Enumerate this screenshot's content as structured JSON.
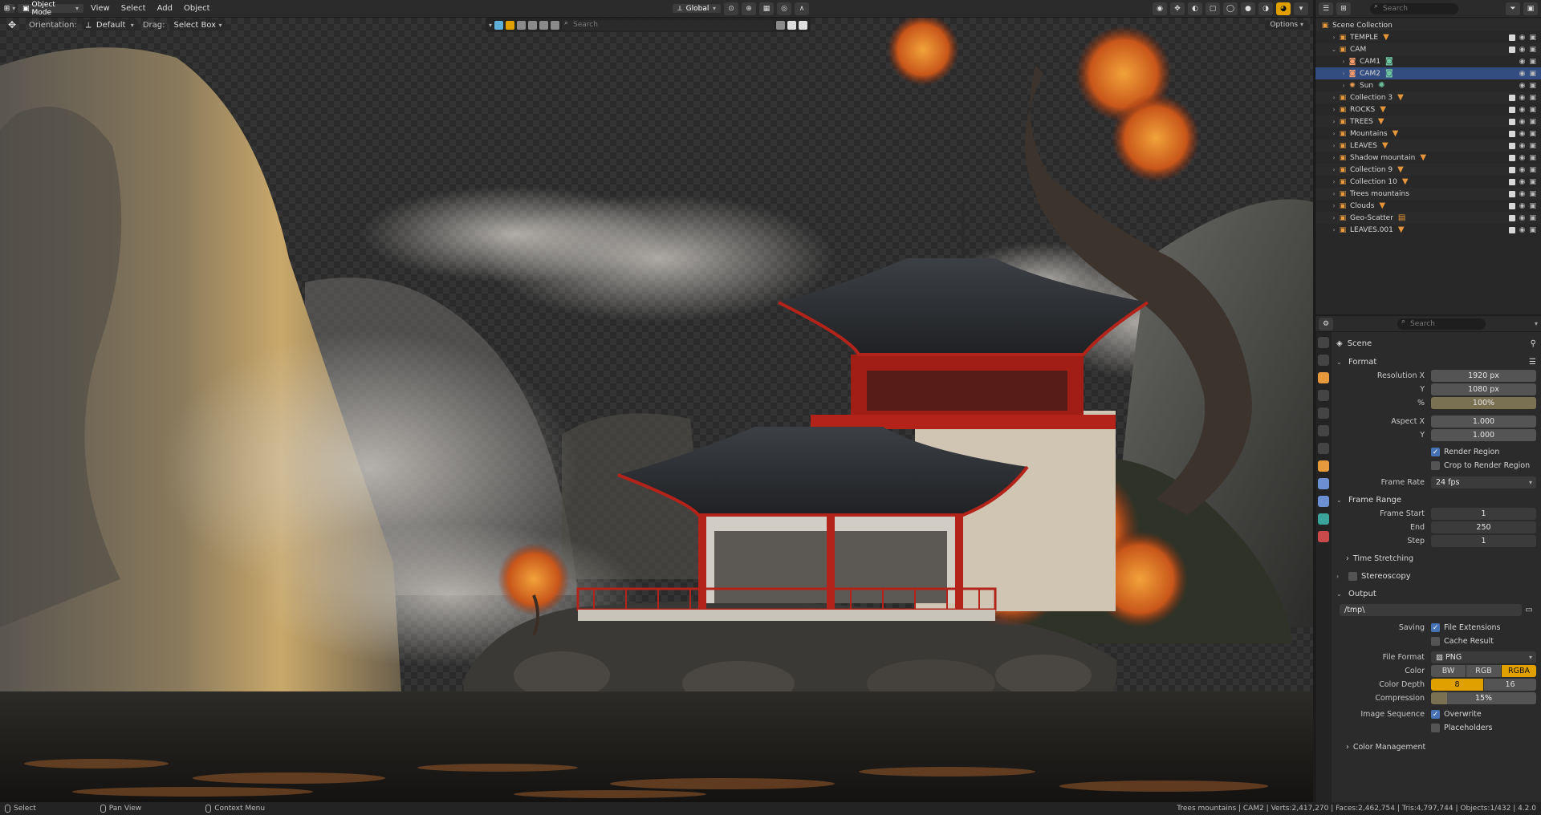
{
  "header": {
    "mode": "Object Mode",
    "menus": [
      "View",
      "Select",
      "Add",
      "Object"
    ],
    "transform_orientation": "Global"
  },
  "tool_settings": {
    "orientation_label": "Orientation:",
    "orientation_value": "Default",
    "drag_label": "Drag:",
    "drag_value": "Select Box",
    "options": "Options",
    "search_placeholder": "Search"
  },
  "outliner": {
    "search_placeholder": "Search",
    "items": [
      {
        "name": "Scene Collection",
        "level": 0,
        "icon": "collection-icon"
      },
      {
        "name": "TEMPLE",
        "level": 1,
        "icon": "collection-icon",
        "tag": "▼"
      },
      {
        "name": "CAM",
        "level": 1,
        "icon": "collection-icon",
        "expanded": true
      },
      {
        "name": "CAM1",
        "level": 2,
        "icon": "camera-icon",
        "tag": "◙"
      },
      {
        "name": "CAM2",
        "level": 2,
        "icon": "camera-icon",
        "tag": "◙",
        "selected": true
      },
      {
        "name": "Sun",
        "level": 2,
        "icon": "sun-icon",
        "tag": "✺"
      },
      {
        "name": "Collection 3",
        "level": 1,
        "icon": "collection-icon",
        "tag": "▼"
      },
      {
        "name": "ROCKS",
        "level": 1,
        "icon": "collection-icon",
        "tag": "▼"
      },
      {
        "name": "TREES",
        "level": 1,
        "icon": "collection-icon",
        "tag": "▼"
      },
      {
        "name": "Mountains",
        "level": 1,
        "icon": "collection-icon",
        "tag": "▼"
      },
      {
        "name": "LEAVES",
        "level": 1,
        "icon": "collection-icon",
        "tag": "▼"
      },
      {
        "name": "Shadow mountain",
        "level": 1,
        "icon": "collection-icon",
        "tag": "▼"
      },
      {
        "name": "Collection 9",
        "level": 1,
        "icon": "collection-icon",
        "tag": "▼"
      },
      {
        "name": "Collection 10",
        "level": 1,
        "icon": "collection-icon",
        "tag": "▼"
      },
      {
        "name": "Trees mountains",
        "level": 1,
        "icon": "collection-icon"
      },
      {
        "name": "Clouds",
        "level": 1,
        "icon": "collection-icon",
        "tag": "▼"
      },
      {
        "name": "Geo-Scatter",
        "level": 1,
        "icon": "collection-icon",
        "tag": "▤"
      },
      {
        "name": "LEAVES.001",
        "level": 1,
        "icon": "collection-icon",
        "tag": "▼"
      }
    ]
  },
  "properties": {
    "search_placeholder": "Search",
    "scene_label": "Scene",
    "format_title": "Format",
    "resolution_x_label": "Resolution X",
    "resolution_x": "1920 px",
    "resolution_y_label": "Y",
    "resolution_y": "1080 px",
    "percent_label": "%",
    "percent": "100%",
    "aspect_x_label": "Aspect X",
    "aspect_x": "1.000",
    "aspect_y_label": "Y",
    "aspect_y": "1.000",
    "render_region": "Render Region",
    "crop_region": "Crop to Render Region",
    "frame_rate_label": "Frame Rate",
    "frame_rate": "24 fps",
    "frame_range_title": "Frame Range",
    "frame_start_label": "Frame Start",
    "frame_start": "1",
    "end_label": "End",
    "end": "250",
    "step_label": "Step",
    "step": "1",
    "time_stretching": "Time Stretching",
    "stereoscopy": "Stereoscopy",
    "output_title": "Output",
    "output_path": "/tmp\\",
    "saving_label": "Saving",
    "file_extensions": "File Extensions",
    "cache_result": "Cache Result",
    "file_format_label": "File Format",
    "file_format": "PNG",
    "color_label": "Color",
    "color_options": [
      "BW",
      "RGB",
      "RGBA"
    ],
    "color_depth_label": "Color Depth",
    "color_depth_options": [
      "8",
      "16"
    ],
    "compression_label": "Compression",
    "compression": "15%",
    "compression_fraction": 0.15,
    "image_sequence_label": "Image Sequence",
    "overwrite": "Overwrite",
    "placeholders": "Placeholders",
    "color_management": "Color Management"
  },
  "statusbar": {
    "select": "Select",
    "pan_view": "Pan View",
    "context_menu": "Context Menu",
    "stats": "Trees mountains | CAM2 | Verts:2,417,270 | Faces:2,462,754 | Tris:4,797,744 | Objects:1/432 | 4.2.0"
  },
  "colors": {
    "accent_blue": "#4772b3",
    "accent_gold": "#e0a000",
    "temple_red": "#b3231a"
  }
}
